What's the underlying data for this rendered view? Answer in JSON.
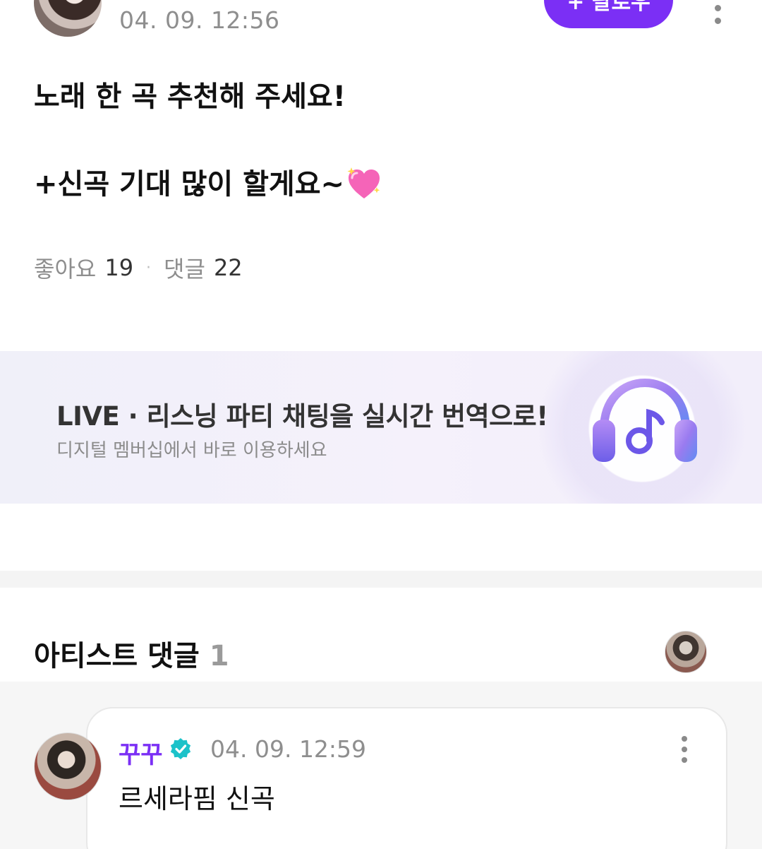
{
  "post": {
    "time": "04. 09. 12:56",
    "follow_label": "+ 팔로우",
    "line1": "노래 한 곡 추천해 주세요!",
    "line2": "+신곡 기대 많이 할게요~",
    "emoji": "sparkling-heart-icon"
  },
  "stats": {
    "likes_label": "좋아요",
    "likes_count": "19",
    "separator": "·",
    "comments_label": "댓글",
    "comments_count": "22"
  },
  "banner": {
    "title": "LIVE · 리스닝 파티 채팅을 실시간 번역으로!",
    "subtitle": "디지털 멤버십에서 바로 이용하세요",
    "icon": "headphones-icon"
  },
  "artist_section": {
    "title": "아티스트 댓글",
    "count": "1"
  },
  "comment": {
    "author": "꾸꾸",
    "time": "04. 09. 12:59",
    "text": "르세라핌 신곡"
  },
  "colors": {
    "accent": "#7b2ff5",
    "verified": "#1cc2c9",
    "muted_text": "#8e8e8e"
  }
}
